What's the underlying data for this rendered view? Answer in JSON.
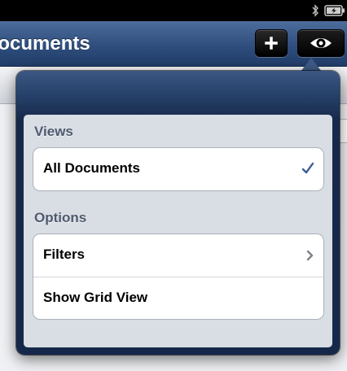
{
  "nav": {
    "title": "Documents",
    "add_button_icon": "plus-icon",
    "view_button_icon": "eye-icon"
  },
  "status_bar": {
    "icons": [
      "bluetooth-icon",
      "battery-charging-icon"
    ]
  },
  "popover": {
    "sections": [
      {
        "header": "Views",
        "items": [
          {
            "label": "All Documents",
            "accessory": "checkmark-icon",
            "selected": true
          }
        ]
      },
      {
        "header": "Options",
        "items": [
          {
            "label": "Filters",
            "accessory": "chevron-right-icon"
          },
          {
            "label": "Show Grid View",
            "accessory": "none"
          }
        ]
      }
    ]
  },
  "colors": {
    "nav_bar": "#2f4e7d",
    "popover_frame": "#17294a",
    "checkmark": "#3d5f97",
    "section_header": "#4f5a6e"
  }
}
